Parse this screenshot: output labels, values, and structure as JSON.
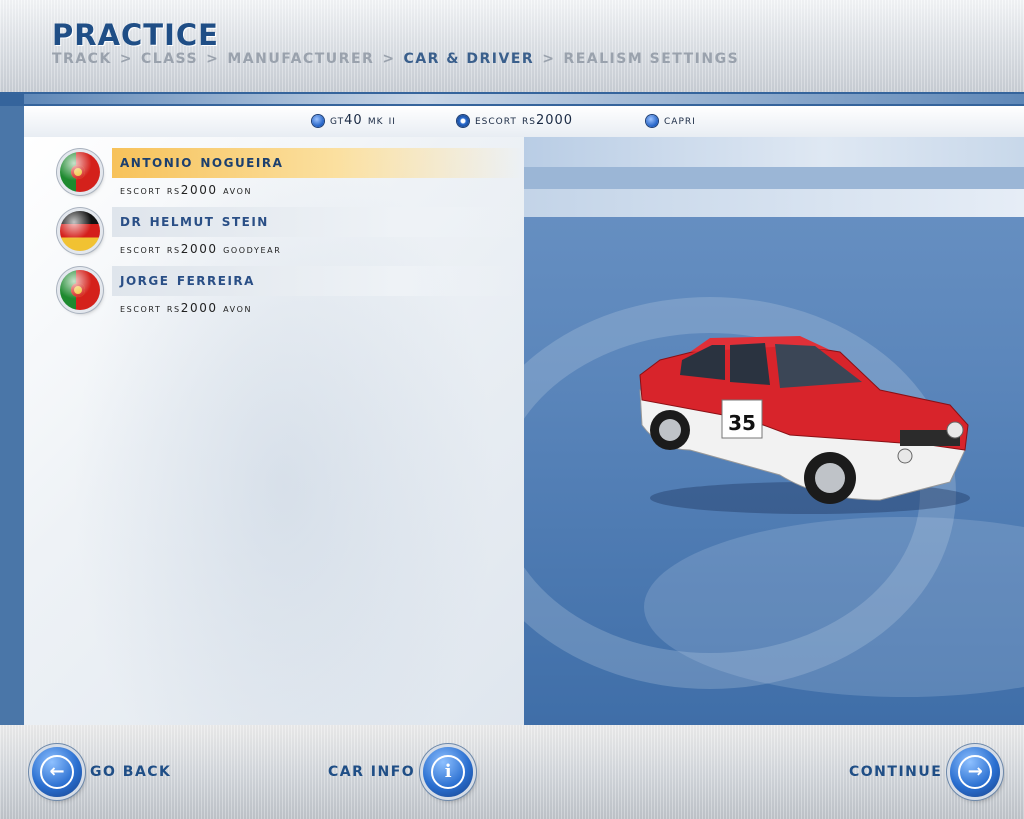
{
  "header": {
    "title": "PRACTICE",
    "breadcrumb": [
      {
        "label": "TRACK",
        "active": false
      },
      {
        "label": "CLASS",
        "active": false
      },
      {
        "label": "MANUFACTURER",
        "active": false
      },
      {
        "label": "CAR & DRIVER",
        "active": true
      },
      {
        "label": "REALISM SETTINGS",
        "active": false
      }
    ],
    "separator": ">"
  },
  "car_tabs": [
    {
      "label": "GT40 Mk II",
      "selected": false
    },
    {
      "label": "Escort RS2000",
      "selected": true
    },
    {
      "label": "Capri",
      "selected": false
    }
  ],
  "drivers": [
    {
      "name": "Antonio Nogueira",
      "car": "Escort RS2000 Avon",
      "flag": "portugal-flag-icon",
      "selected": true
    },
    {
      "name": "Dr Helmut Stein",
      "car": "Escort RS2000 Goodyear",
      "flag": "germany-flag-icon",
      "selected": false
    },
    {
      "name": "Jorge Ferreira",
      "car": "Escort RS2000 Avon",
      "flag": "portugal-flag-icon",
      "selected": false
    }
  ],
  "car_preview": {
    "number": "35",
    "livery_colors": {
      "primary": "#d8242b",
      "secondary": "#f4f4f4"
    }
  },
  "footer": {
    "go_back": "GO BACK",
    "car_info": "CAR INFO",
    "continue": "CONTINUE"
  },
  "colors": {
    "accent_blue": "#1f4e86",
    "selected_highlight": "#f7c25a",
    "panel_blue": "#4a76a8"
  }
}
